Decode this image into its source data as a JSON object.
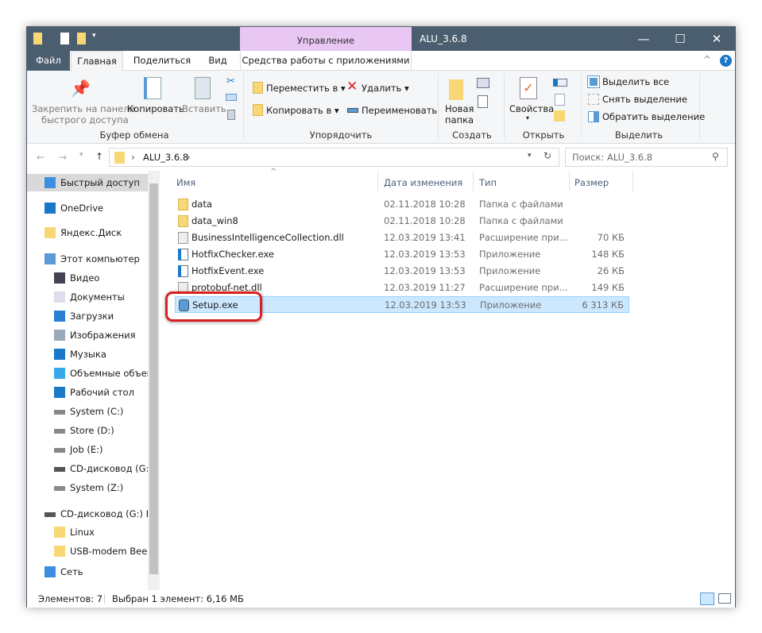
{
  "window": {
    "title": "ALU_3.6.8",
    "context_tab": "Управление",
    "minimize": "—",
    "maximize": "☐",
    "close": "✕"
  },
  "tabs": [
    "Файл",
    "Главная",
    "Поделиться",
    "Вид",
    "Средства работы с приложениями"
  ],
  "ribbon": {
    "clipboard": {
      "pin": "Закрепить на панели",
      "pin2": "быстрого доступа",
      "copy": "Копировать",
      "paste": "Вставить",
      "group": "Буфер обмена"
    },
    "organize": {
      "move": "Переместить в",
      "copy_to": "Копировать в",
      "delete": "Удалить",
      "rename": "Переименовать",
      "group": "Упорядочить"
    },
    "create": {
      "new_folder": "Новая",
      "new_folder2": "папка",
      "group": "Создать"
    },
    "open": {
      "properties": "Свойства",
      "group": "Открыть"
    },
    "select": {
      "all": "Выделить все",
      "none": "Снять выделение",
      "invert": "Обратить выделение",
      "group": "Выделить"
    }
  },
  "address": {
    "path": "ALU_3.6.8",
    "search_placeholder": "Поиск: ALU_3.6.8"
  },
  "sidebar": [
    {
      "label": "Быстрый доступ",
      "icon": "star-icon"
    },
    {
      "label": "OneDrive",
      "icon": "cloud-icon"
    },
    {
      "label": "Яндекс.Диск",
      "icon": "yandex-disk-icon"
    },
    {
      "label": "Этот компьютер",
      "icon": "computer-icon"
    },
    {
      "label": "Видео",
      "icon": "video-icon"
    },
    {
      "label": "Документы",
      "icon": "documents-icon"
    },
    {
      "label": "Загрузки",
      "icon": "download-icon"
    },
    {
      "label": "Изображения",
      "icon": "pictures-icon"
    },
    {
      "label": "Музыка",
      "icon": "music-icon"
    },
    {
      "label": "Объемные объекты",
      "icon": "3d-objects-icon"
    },
    {
      "label": "Рабочий стол",
      "icon": "desktop-icon"
    },
    {
      "label": "System (C:)",
      "icon": "drive-icon"
    },
    {
      "label": "Store (D:)",
      "icon": "drive-icon"
    },
    {
      "label": "Job (E:)",
      "icon": "drive-icon"
    },
    {
      "label": "CD-дисковод (G:)",
      "icon": "cd-drive-icon"
    },
    {
      "label": "System (Z:)",
      "icon": "drive-icon"
    },
    {
      "label": "CD-дисковод (G:) Beeline",
      "icon": "cd-drive-icon"
    },
    {
      "label": "Linux",
      "icon": "folder-icon"
    },
    {
      "label": "USB-modem Beeline",
      "icon": "folder-icon"
    },
    {
      "label": "Сеть",
      "icon": "network-icon"
    }
  ],
  "columns": {
    "name": "Имя",
    "date": "Дата изменения",
    "type": "Тип",
    "size": "Размер"
  },
  "files": [
    {
      "name": "data",
      "date": "02.11.2018 10:28",
      "type": "Папка с файлами",
      "size": "",
      "icon": "folder-icon"
    },
    {
      "name": "data_win8",
      "date": "02.11.2018 10:28",
      "type": "Папка с файлами",
      "size": "",
      "icon": "folder-icon"
    },
    {
      "name": "BusinessIntelligenceCollection.dll",
      "date": "12.03.2019 13:41",
      "type": "Расширение при...",
      "size": "70 КБ",
      "icon": "dll-icon"
    },
    {
      "name": "HotfixChecker.exe",
      "date": "12.03.2019 13:53",
      "type": "Приложение",
      "size": "148 КБ",
      "icon": "exe-icon"
    },
    {
      "name": "HotfixEvent.exe",
      "date": "12.03.2019 13:53",
      "type": "Приложение",
      "size": "26 КБ",
      "icon": "exe-icon"
    },
    {
      "name": "protobuf-net.dll",
      "date": "12.03.2019 11:27",
      "type": "Расширение при...",
      "size": "149 КБ",
      "icon": "dll-icon"
    },
    {
      "name": "Setup.exe",
      "date": "12.03.2019 13:53",
      "type": "Приложение",
      "size": "6 313 КБ",
      "icon": "setup-icon",
      "selected": true
    }
  ],
  "status": {
    "count": "Элементов: 7",
    "selection": "Выбран 1 элемент: 6,16 МБ"
  },
  "colors": {
    "titlebar": "#4b5e6f",
    "context_tab": "#e9c7f3",
    "selection": "#cce8ff",
    "highlight": "#d9201f"
  }
}
